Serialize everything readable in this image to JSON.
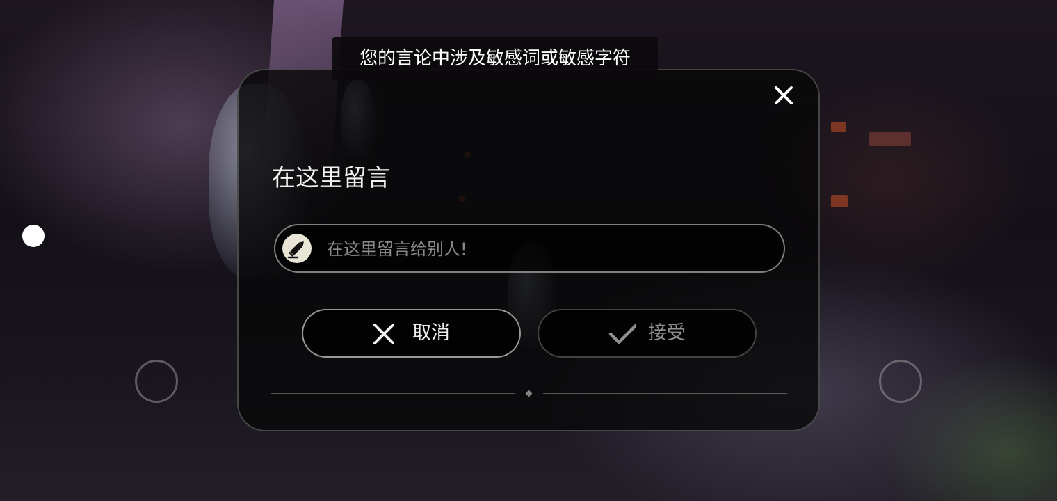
{
  "toast": {
    "message": "您的言论中涉及敏感词或敏感字符"
  },
  "dialog": {
    "close_icon": "close-icon",
    "title": "在这里留言",
    "message_input": {
      "icon": "pencil-icon",
      "placeholder": "在这里留言给别人!",
      "value": ""
    },
    "buttons": {
      "cancel": {
        "label": "取消",
        "icon": "x-icon"
      },
      "accept": {
        "label": "接受",
        "icon": "checkmark-icon"
      }
    }
  },
  "hud": {
    "left_indicator": "white-dot",
    "left_joystick": "ring",
    "right_joystick": "ring"
  },
  "colors": {
    "panel_background": "#080708",
    "text_primary": "#f2f2f2",
    "text_disabled": "#8f8f8f",
    "pencil_badge": "#e9e6d8"
  }
}
